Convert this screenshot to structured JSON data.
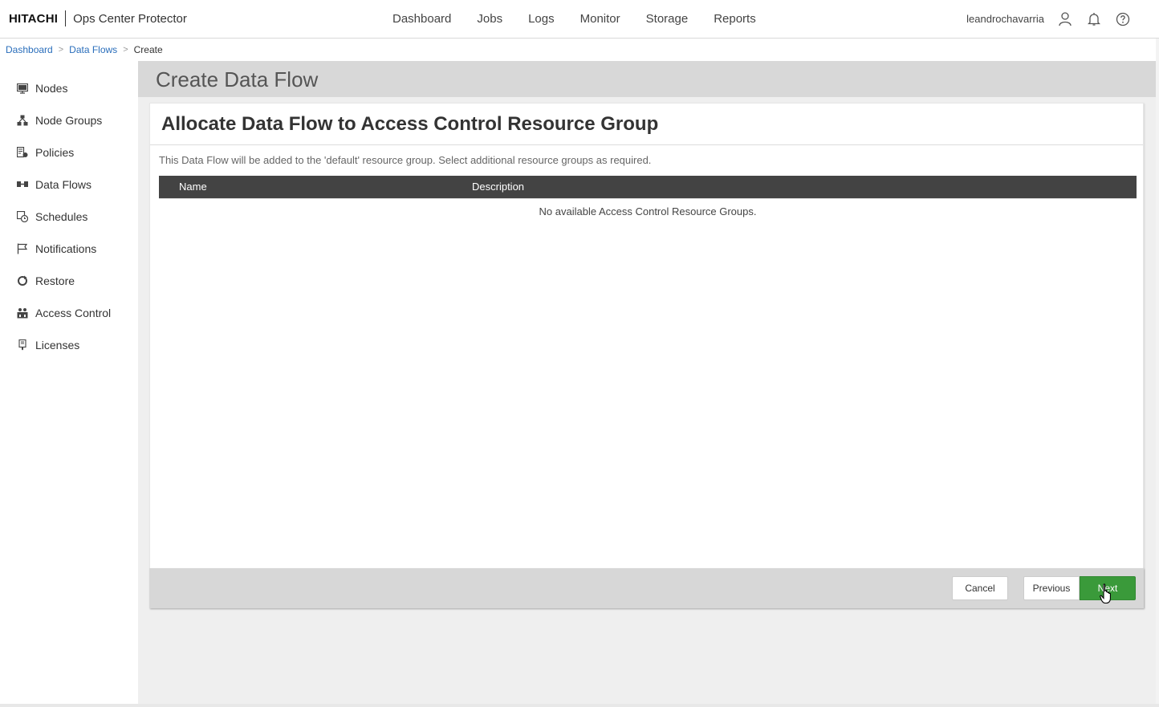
{
  "header": {
    "brand_logo": "HITACHI",
    "product_name": "Ops Center Protector",
    "nav": [
      "Dashboard",
      "Jobs",
      "Logs",
      "Monitor",
      "Storage",
      "Reports"
    ],
    "username": "leandrochavarria",
    "icons": [
      "user-icon",
      "bell-icon",
      "help-icon"
    ]
  },
  "breadcrumb": {
    "items": [
      "Dashboard",
      "Data Flows"
    ],
    "separator": ">",
    "current": "Create"
  },
  "sidebar": {
    "items": [
      {
        "label": "Nodes",
        "icon": "monitor-icon"
      },
      {
        "label": "Node Groups",
        "icon": "node-groups-icon"
      },
      {
        "label": "Policies",
        "icon": "policies-icon"
      },
      {
        "label": "Data Flows",
        "icon": "data-flows-icon"
      },
      {
        "label": "Schedules",
        "icon": "schedules-icon"
      },
      {
        "label": "Notifications",
        "icon": "flag-icon"
      },
      {
        "label": "Restore",
        "icon": "restore-icon"
      },
      {
        "label": "Access Control",
        "icon": "access-control-icon"
      },
      {
        "label": "Licenses",
        "icon": "license-icon"
      }
    ]
  },
  "page": {
    "title": "Create Data Flow"
  },
  "panel": {
    "title": "Allocate Data Flow to Access Control Resource Group",
    "description": "This Data Flow will be added to the 'default' resource group. Select additional resource groups as required.",
    "table": {
      "columns": [
        "Name",
        "Description"
      ],
      "empty_message": "No available Access Control Resource Groups."
    }
  },
  "footer": {
    "cancel_label": "Cancel",
    "previous_label": "Previous",
    "next_label": "Next"
  },
  "colors": {
    "accent_green": "#3a9a3a",
    "table_header": "#434343",
    "link_blue": "#2a6ebb"
  }
}
